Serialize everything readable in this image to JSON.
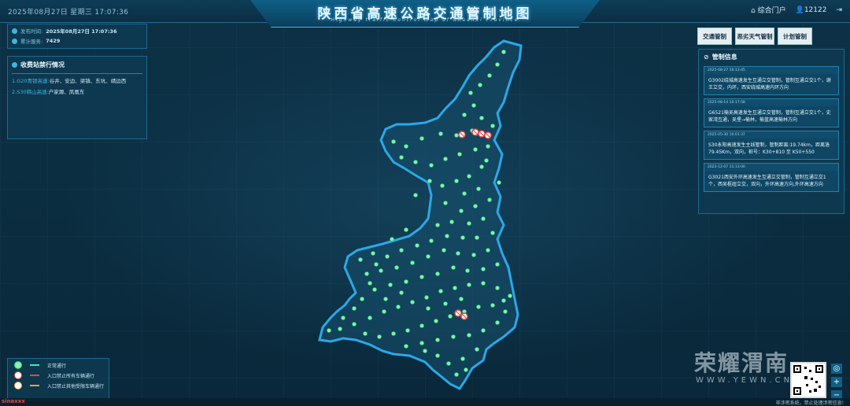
{
  "header": {
    "datetime": "2025年08月27日 星期三  17:07:36",
    "title": "陕西省高速公路交通管制地图",
    "subtitle": "Highway traffic control map of Shaanxi Province",
    "portal": "综合门户",
    "user": "12122"
  },
  "info_panel": {
    "publish_label": "发布时间:",
    "publish_value": "2025年08月27日 17:07:36",
    "visits_label": "累计服务:",
    "visits_value": "7429"
  },
  "toll_panel": {
    "title": "收费站禁行情况",
    "items": [
      {
        "route": "1.G20青银高速:",
        "stations": "谷井、安边、梁镇、东坑、靖边西"
      },
      {
        "route": "2.S30韩山高速:",
        "stations": "户家塬、凤凰东"
      }
    ]
  },
  "tabs": [
    "交通管制",
    "恶劣天气管制",
    "计划管制"
  ],
  "control_panel": {
    "title": "管制信息",
    "cards": [
      {
        "date": "2025-08-27 16:13:45",
        "text": "G3002绕城高速发生互通立交管制，管制互通立交1个，谢王立交，内环，西安绕城高速内环方向"
      },
      {
        "date": "2025-08-14 10:17:58",
        "text": "G6521榆吴高速发生互通立交管制，管制互通立交1个，史家湾互通，吴堡→榆林，榆蓝高速榆林方向"
      },
      {
        "date": "2025-05-30 10:01:37",
        "text": "S30永阳高速发生主线管制，管制距离:19.74km，距离洛79.45Km，双向，桩号：K30+810 至 K50+550"
      },
      {
        "date": "2023-12-07 11:13:00",
        "text": "G3021西安外环高速发生互通立交管制，管制互通立交1个，西吴枢纽立交，双向，外环高速方向,外环高速方向"
      }
    ]
  },
  "legend": [
    {
      "label": "正常通行",
      "color": "#3ee6c6"
    },
    {
      "label": "入口禁止所有车辆通行",
      "color": "#e64545"
    },
    {
      "label": "入口禁止其他受限车辆通行",
      "color": "#f0a040"
    }
  ],
  "watermark": {
    "brand": "荣耀渭南",
    "url": "WWW.YEWN.CN"
  },
  "footer": {
    "text": "非涉密系统，禁止处理涉密信息!",
    "left": "sinaxxx"
  },
  "colors": {
    "map_stroke": "#2ba8e8",
    "node": "#8ef0b0",
    "blocked": "#e64545"
  }
}
